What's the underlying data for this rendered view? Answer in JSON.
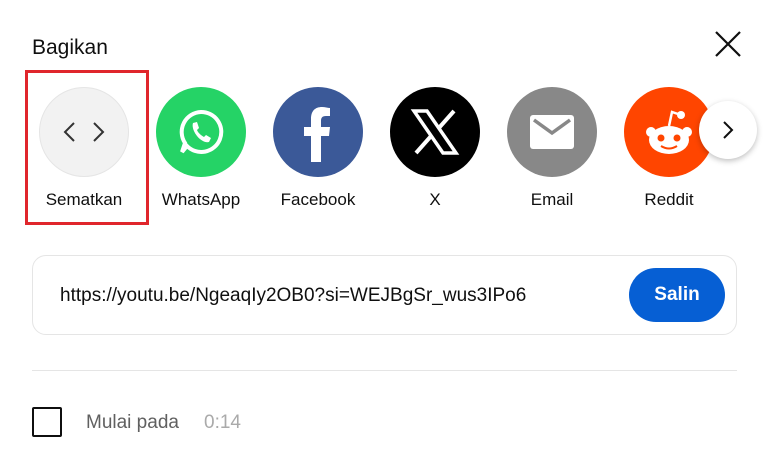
{
  "dialog": {
    "title": "Bagikan",
    "close_icon": "close-icon"
  },
  "share_targets": [
    {
      "label": "Sematkan",
      "icon": "embed-code-icon",
      "color": "#f2f2f2",
      "highlighted": true
    },
    {
      "label": "WhatsApp",
      "icon": "whatsapp-icon",
      "color": "#25d366"
    },
    {
      "label": "Facebook",
      "icon": "facebook-icon",
      "color": "#3b5998"
    },
    {
      "label": "X",
      "icon": "x-icon",
      "color": "#000000"
    },
    {
      "label": "Email",
      "icon": "email-icon",
      "color": "#888888"
    },
    {
      "label": "Reddit",
      "icon": "reddit-icon",
      "color": "#ff4500"
    }
  ],
  "next_icon": "chevron-right-icon",
  "link": {
    "url": "https://youtu.be/NgeaqIy2OB0?si=WEJBgSr_wus3IPo6",
    "copy_label": "Salin",
    "copy_color": "#065fd4"
  },
  "start_at": {
    "label": "Mulai pada",
    "time": "0:14",
    "checked": false
  },
  "highlight_color": "#e0262c"
}
